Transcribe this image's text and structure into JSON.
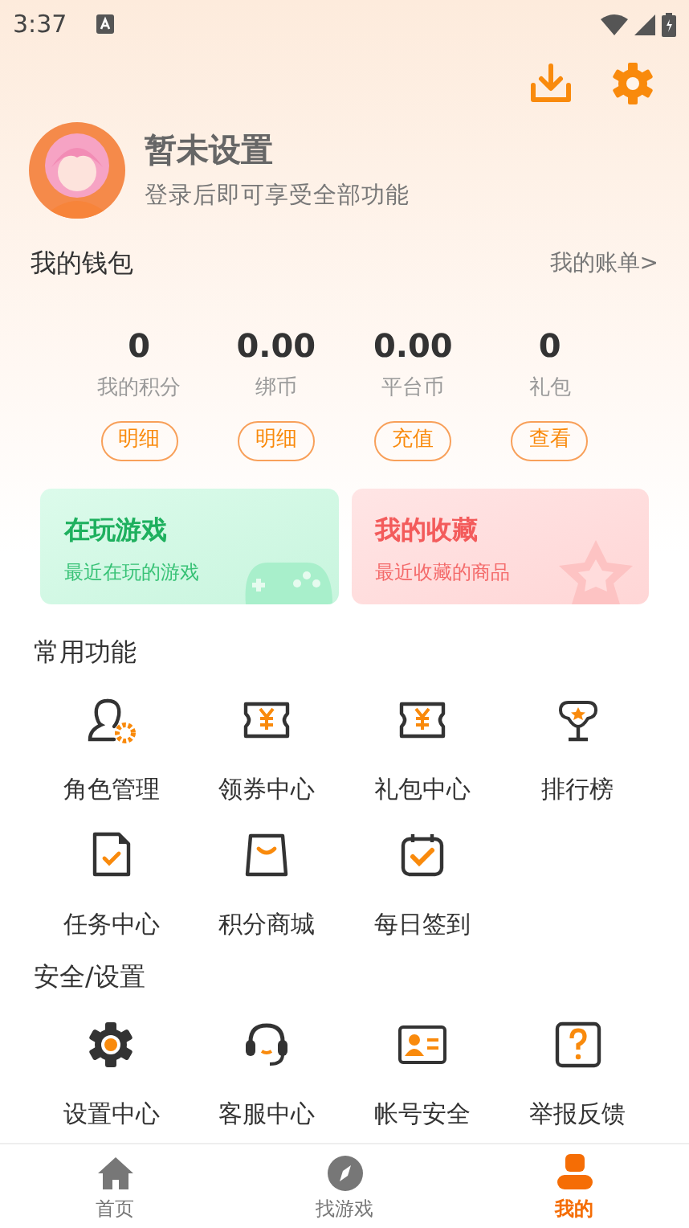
{
  "status_bar": {
    "time": "3:37"
  },
  "profile": {
    "name": "暂未设置",
    "subtitle": "登录后即可享受全部功能"
  },
  "wallet": {
    "title": "我的钱包",
    "link": "我的账单>",
    "items": [
      {
        "value": "0",
        "label": "我的积分",
        "action": "明细"
      },
      {
        "value": "0.00",
        "label": "绑币",
        "action": "明细"
      },
      {
        "value": "0.00",
        "label": "平台币",
        "action": "充值"
      },
      {
        "value": "0",
        "label": "礼包",
        "action": "查看"
      }
    ]
  },
  "cards": [
    {
      "kind": "games",
      "title": "在玩游戏",
      "subtitle": "最近在玩的游戏"
    },
    {
      "kind": "favorites",
      "title": "我的收藏",
      "subtitle": "最近收藏的商品"
    }
  ],
  "sections": [
    {
      "title": "常用功能",
      "items": [
        {
          "kind": "role",
          "label": "角色管理"
        },
        {
          "kind": "coupon",
          "label": "领券中心"
        },
        {
          "kind": "coupon",
          "label": "礼包中心"
        },
        {
          "kind": "trophy",
          "label": "排行榜"
        },
        {
          "kind": "task",
          "label": "任务中心"
        },
        {
          "kind": "bag",
          "label": "积分商城"
        },
        {
          "kind": "calendar",
          "label": "每日签到"
        }
      ]
    },
    {
      "title": "安全/设置",
      "items": [
        {
          "kind": "gear",
          "label": "设置中心"
        },
        {
          "kind": "headset",
          "label": "客服中心"
        },
        {
          "kind": "idcard",
          "label": "帐号安全"
        },
        {
          "kind": "question",
          "label": "举报反馈"
        }
      ]
    }
  ],
  "nav": [
    {
      "kind": "home",
      "label": "首页",
      "selected": false
    },
    {
      "kind": "compass",
      "label": "找游戏",
      "selected": false
    },
    {
      "kind": "person",
      "label": "我的",
      "selected": true
    }
  ]
}
